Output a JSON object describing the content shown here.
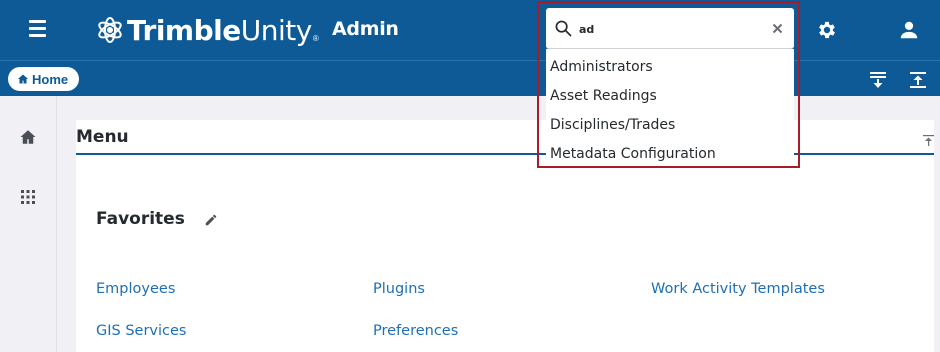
{
  "header": {
    "logo_bold": "Trimble",
    "logo_regular": "Unity",
    "logo_reg_mark": "®",
    "section": "Admin"
  },
  "search": {
    "value": "ad",
    "results": [
      "Administrators",
      "Asset Readings",
      "Disciplines/Trades",
      "Metadata Configuration"
    ]
  },
  "subbar": {
    "home_label": "Home"
  },
  "menu": {
    "title": "Menu",
    "favorites_title": "Favorites",
    "favorites": {
      "col1": [
        "Employees",
        "GIS Services"
      ],
      "col2": [
        "Plugins",
        "Preferences"
      ],
      "col3": [
        "Work Activity Templates"
      ]
    }
  },
  "colors": {
    "brand": "#0e5a96",
    "link": "#1f6fb5",
    "highlight": "#a81c2a"
  },
  "icons": [
    "hamburger-icon",
    "trimble-logo-icon",
    "gear-icon",
    "user-icon",
    "home-icon",
    "expand-all-icon",
    "collapse-all-icon",
    "apps-grid-icon",
    "collapse-icon",
    "pencil-icon",
    "search-icon",
    "clear-icon"
  ]
}
